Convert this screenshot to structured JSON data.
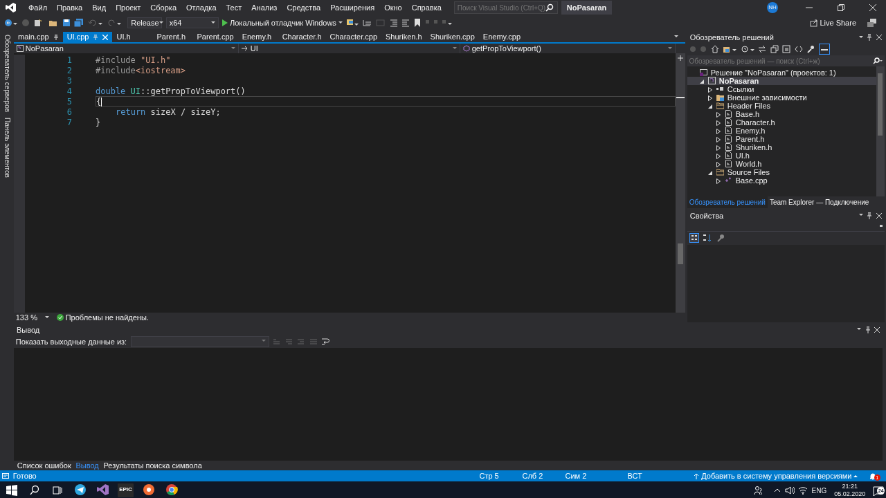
{
  "window": {
    "title": "NoPasaran",
    "avatar": "NH"
  },
  "menu": [
    "Файл",
    "Правка",
    "Вид",
    "Проект",
    "Сборка",
    "Отладка",
    "Тест",
    "Анализ",
    "Средства",
    "Расширения",
    "Окно",
    "Справка"
  ],
  "search": {
    "placeholder": "Поиск Visual Studio (Ctrl+Q)"
  },
  "toolbar": {
    "configuration": "Release",
    "platform": "x64",
    "debugger": "Локальный отладчик Windows",
    "live_share": "Live Share"
  },
  "side_strip": [
    "Обозреватель серверов",
    "Панель элементов"
  ],
  "editor_tabs": [
    {
      "label": "main.cpp",
      "selected": false,
      "pinned": true
    },
    {
      "label": "UI.cpp",
      "selected": true,
      "pinned": true
    },
    {
      "label": "UI.h",
      "selected": false,
      "pinned": false
    },
    {
      "label": "Parent.h",
      "selected": false,
      "pinned": false
    },
    {
      "label": "Parent.cpp",
      "selected": false,
      "pinned": false
    },
    {
      "label": "Enemy.h",
      "selected": false,
      "pinned": false
    },
    {
      "label": "Character.h",
      "selected": false,
      "pinned": false
    },
    {
      "label": "Character.cpp",
      "selected": false,
      "pinned": false
    },
    {
      "label": "Shuriken.h",
      "selected": false,
      "pinned": false
    },
    {
      "label": "Shuriken.cpp",
      "selected": false,
      "pinned": false
    },
    {
      "label": "Enemy.cpp",
      "selected": false,
      "pinned": false
    }
  ],
  "navigation": {
    "project": "NoPasaran",
    "scope": "UI",
    "member": "getPropToViewport()"
  },
  "code": [
    {
      "number": "1",
      "current": false,
      "tokens": [
        {
          "kind": "preprocessor",
          "text": "#include "
        },
        {
          "kind": "string",
          "text": "\"UI.h\""
        }
      ]
    },
    {
      "number": "2",
      "current": false,
      "tokens": [
        {
          "kind": "preprocessor",
          "text": "#include"
        },
        {
          "kind": "string",
          "text": "<iostream>"
        }
      ]
    },
    {
      "number": "3",
      "current": false
    },
    {
      "number": "4",
      "current": false,
      "tokens": [
        {
          "kind": "keyword",
          "text": "double "
        },
        {
          "kind": "type",
          "text": "UI"
        },
        {
          "kind": "plain",
          "text": "::getPropToViewport()"
        }
      ]
    },
    {
      "number": "5",
      "current": true,
      "tokens": [
        {
          "kind": "plain",
          "text": "{"
        }
      ]
    },
    {
      "number": "6",
      "current": false,
      "indented": true,
      "tokens": [
        {
          "kind": "keyword",
          "text": "return "
        },
        {
          "kind": "plain",
          "text": "sizeX / sizeY;"
        }
      ]
    },
    {
      "number": "7",
      "current": false,
      "tokens": [
        {
          "kind": "plain",
          "text": "}"
        }
      ]
    }
  ],
  "editor_status": {
    "zoom": "133 %",
    "issues": "Проблемы не найдены."
  },
  "solution_explorer": {
    "title": "Обозреватель решений",
    "search": {
      "placeholder": "Обозреватель решений — поиск (Ctrl+ж)"
    },
    "tree": [
      {
        "label": "Решение \"NoPasaran\"  (проектов: 1)",
        "kind": "solution",
        "selected": false,
        "children": [
          {
            "label": "NoPasaran",
            "kind": "project",
            "selected": true,
            "expanded": true,
            "children": [
              {
                "label": "Ссылки",
                "kind": "references",
                "selected": false,
                "expanded": false
              },
              {
                "label": "Внешние зависимости",
                "kind": "dependencies",
                "selected": false,
                "expanded": false
              },
              {
                "label": "Header Files",
                "kind": "folder",
                "selected": false,
                "expanded": true,
                "children": [
                  {
                    "label": "Base.h",
                    "kind": "header",
                    "selected": false,
                    "expanded": false
                  },
                  {
                    "label": "Character.h",
                    "kind": "header",
                    "selected": false,
                    "expanded": false
                  },
                  {
                    "label": "Enemy.h",
                    "kind": "header",
                    "selected": false,
                    "expanded": false
                  },
                  {
                    "label": "Parent.h",
                    "kind": "header",
                    "selected": false,
                    "expanded": false
                  },
                  {
                    "label": "Shuriken.h",
                    "kind": "header",
                    "selected": false,
                    "expanded": false
                  },
                  {
                    "label": "UI.h",
                    "kind": "header",
                    "selected": false,
                    "expanded": false
                  },
                  {
                    "label": "World.h",
                    "kind": "header",
                    "selected": false,
                    "expanded": false
                  }
                ]
              },
              {
                "label": "Source Files",
                "kind": "folder",
                "selected": false,
                "expanded": true,
                "children": [
                  {
                    "label": "Base.cpp",
                    "kind": "source",
                    "selected": false,
                    "expanded": false
                  }
                ]
              }
            ]
          }
        ]
      }
    ],
    "tabs": [
      {
        "label": "Обозреватель решений",
        "selected": true
      },
      {
        "label": "Team Explorer — Подключение",
        "selected": false
      }
    ]
  },
  "properties": {
    "title": "Свойства"
  },
  "output": {
    "title": "Вывод",
    "source_label": "Показать выходные данные из:"
  },
  "bottom_tabs": [
    {
      "label": "Список ошибок",
      "selected": false
    },
    {
      "label": "Вывод",
      "selected": true
    },
    {
      "label": "Результаты поиска символа",
      "selected": false
    }
  ],
  "status_bar": {
    "state": "Готово",
    "line": "Стр 5",
    "column": "Слб 2",
    "char": "Сим 2",
    "mode": "ВСТ",
    "source_control": "Добавить в систему управления версиями",
    "notifications": "1"
  },
  "taskbar": {
    "epic_label": "EPIC",
    "language": "ENG",
    "time": "21:21",
    "date": "05.02.2020",
    "notifications": "24"
  }
}
